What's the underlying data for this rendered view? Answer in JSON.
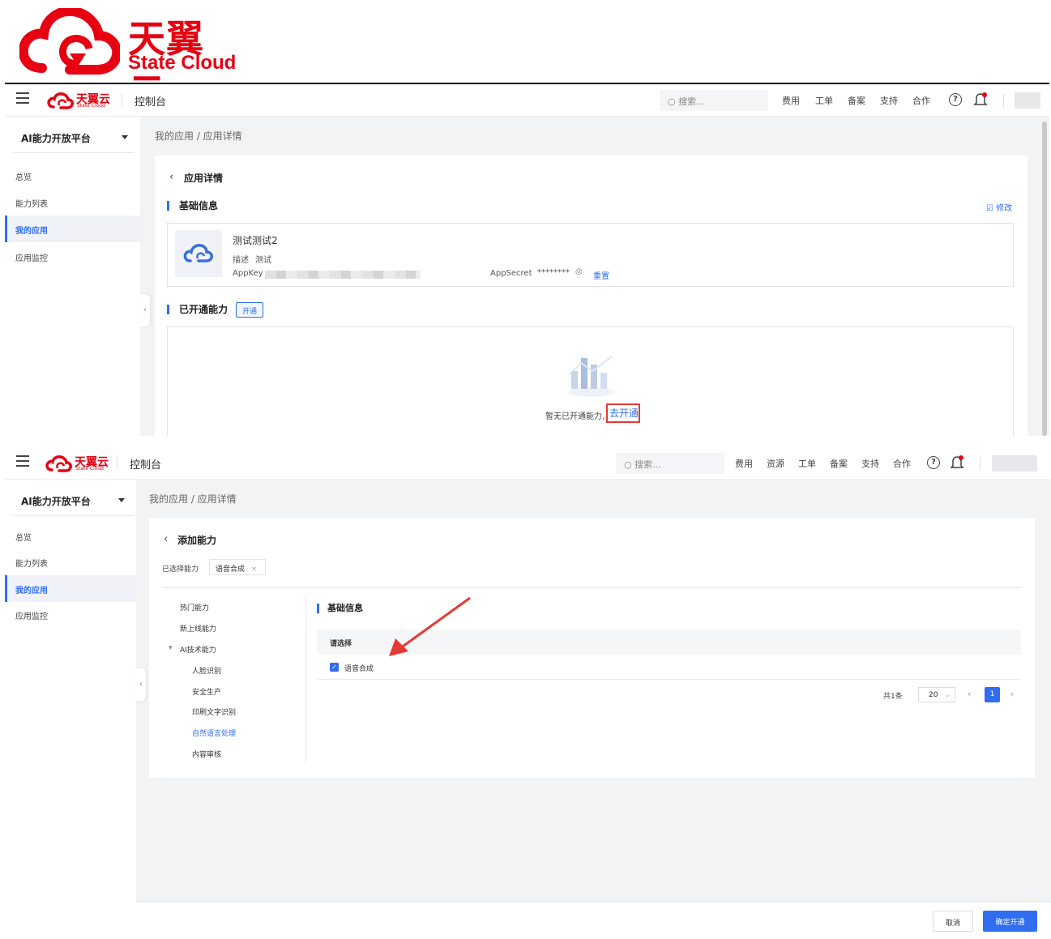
{
  "brand": {
    "cn": "天翼云",
    "en": "State Cloud",
    "mini_cn": "天翼云",
    "mini_en": "State Cloud"
  },
  "colors": {
    "brand_red": "#e60012",
    "accent_blue": "#2f6ef0",
    "annotation_red": "#e53935"
  },
  "topbar1": {
    "console": "控制台",
    "search_placeholder": "搜索...",
    "nav": [
      "费用",
      "工单",
      "备案",
      "支持",
      "合作"
    ]
  },
  "topbar2": {
    "console": "控制台",
    "search_placeholder": "搜索...",
    "nav": [
      "费用",
      "资源",
      "工单",
      "备案",
      "支持",
      "合作"
    ]
  },
  "sidebar": {
    "title": "AI能力开放平台",
    "items": [
      "总览",
      "能力列表",
      "我的应用",
      "应用监控"
    ],
    "active": "我的应用"
  },
  "screen1": {
    "breadcrumb": "我的应用 / 应用详情",
    "page_title": "应用详情",
    "basic_section": "基础信息",
    "edit_label": "修改",
    "app_name": "测试测试2",
    "desc_label": "描述",
    "desc_value": "测试",
    "appkey_label": "AppKey",
    "appsecret_label": "AppSecret",
    "appsecret_value": "********",
    "reset_label": "重置",
    "enabled_section": "已开通能力",
    "open_btn": "开通",
    "empty_text": "暂无已开通能力,",
    "go_open_link": "去开通"
  },
  "screen2": {
    "breadcrumb": "我的应用 / 应用详情",
    "page_title": "添加能力",
    "selected_label": "已选择能力",
    "selected_tag": "语音合成",
    "tree": {
      "hot": "热门能力",
      "new": "新上线能力",
      "ai_group": "AI技术能力",
      "children": [
        "人脸识别",
        "安全生产",
        "印刷文字识别",
        "自然语言处理",
        "内容审核"
      ],
      "active_child": "自然语言处理"
    },
    "basic_section": "基础信息",
    "table_header": "请选择",
    "row_label": "语音合成",
    "total_text": "共1条",
    "page_size": "20",
    "current_page": "1",
    "cancel_btn": "取消",
    "confirm_btn": "确定开通"
  }
}
